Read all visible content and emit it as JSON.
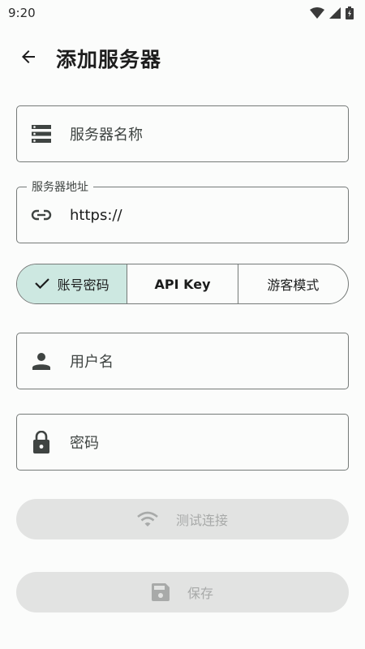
{
  "status_bar": {
    "time": "9:20"
  },
  "header": {
    "title": "添加服务器"
  },
  "form": {
    "server_name": {
      "placeholder": "服务器名称"
    },
    "server_address": {
      "label": "服务器地址",
      "value": "https://"
    },
    "auth_mode": {
      "options": [
        "账号密码",
        "API Key",
        "游客模式"
      ],
      "selected": "账号密码"
    },
    "username": {
      "placeholder": "用户名"
    },
    "password": {
      "placeholder": "密码"
    }
  },
  "actions": {
    "test_connection": "测试连接",
    "save": "保存"
  },
  "colors": {
    "accent_selected": "#cde8e1",
    "icon_dark": "#3f4442",
    "border": "#757a78",
    "disabled_bg": "#e2e3e2",
    "disabled_text": "#a8aaa9"
  }
}
